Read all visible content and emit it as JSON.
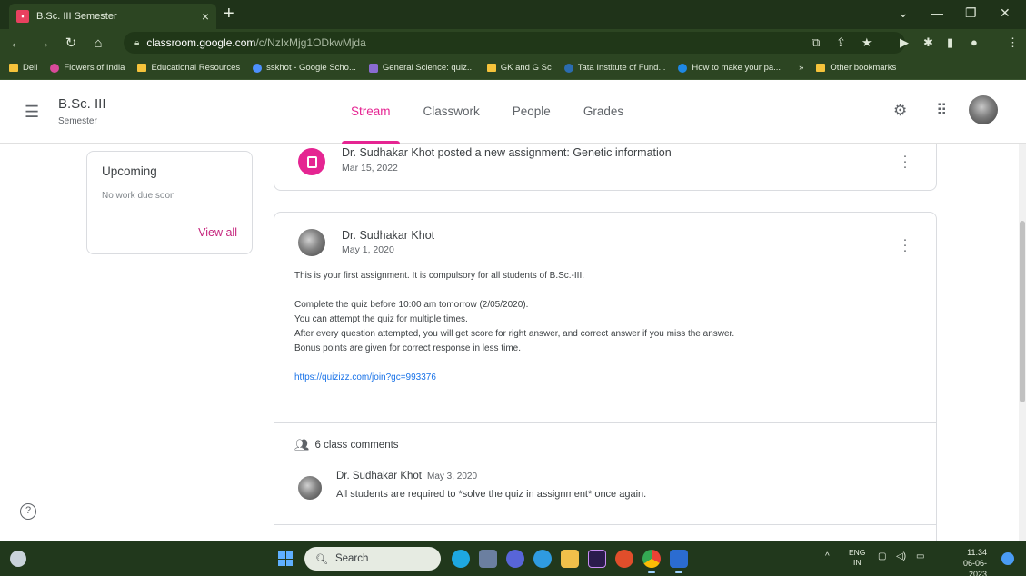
{
  "browser": {
    "tab_title": "B.Sc. III Semester",
    "tab_favicon": "classroom-icon",
    "url_host": "classroom.google.com",
    "url_path": "/c/NzIxMjg1ODkwMjda",
    "bookmarks": [
      {
        "label": "Dell",
        "icon": "folder-icon"
      },
      {
        "label": "Flowers of India",
        "icon": "flower-icon"
      },
      {
        "label": "Educational Resources",
        "icon": "folder-icon"
      },
      {
        "label": "sskhot - Google Scho...",
        "icon": "scholar-icon"
      },
      {
        "label": "General Science: quiz...",
        "icon": "quiz-icon"
      },
      {
        "label": "GK and G Sc",
        "icon": "folder-icon"
      },
      {
        "label": "Tata Institute of Fund...",
        "icon": "tifr-icon"
      },
      {
        "label": "How to make your pa...",
        "icon": "edge-icon"
      },
      {
        "label": "»",
        "icon": ""
      },
      {
        "label": "Other bookmarks",
        "icon": "folder-icon"
      }
    ]
  },
  "header": {
    "class_name": "B.Sc. III",
    "section": "Semester",
    "tabs": [
      {
        "label": "Stream",
        "active": true
      },
      {
        "label": "Classwork",
        "active": false
      },
      {
        "label": "People",
        "active": false
      },
      {
        "label": "Grades",
        "active": false
      }
    ]
  },
  "upcoming": {
    "title": "Upcoming",
    "empty_text": "No work due soon",
    "view_all": "View all"
  },
  "stream": {
    "assignment_post": {
      "title": "Dr. Sudhakar Khot posted a new assignment: Genetic information",
      "date": "Mar 15, 2022"
    },
    "announcement": {
      "author": "Dr. Sudhakar Khot",
      "date": "May 1, 2020",
      "line1": "This is your first assignment. It is compulsory for all students of B.Sc.-III.",
      "line2": "Complete the quiz before 10:00 am tomorrow (2/05/2020).",
      "line3": "You can attempt the quiz for multiple times.",
      "line4": "After every question attempted, you will get score for right answer, and correct answer if you miss the answer.",
      "line5": "Bonus points are given for correct response in less time.",
      "link": "https://quizizz.com/join?gc=993376",
      "comments_count": "6 class comments",
      "comment": {
        "author": "Dr. Sudhakar Khot",
        "date": "May 3, 2020",
        "text": "All students are required to *solve the quiz in assignment* once again."
      }
    }
  },
  "taskbar": {
    "search_placeholder": "Search",
    "lang_top": "ENG",
    "lang_bottom": "IN",
    "time": "11:34",
    "date": "06-06-2023"
  },
  "colors": {
    "accent": "#e52592",
    "link": "#1a73e8",
    "chrome_bg": "#2c4522"
  }
}
